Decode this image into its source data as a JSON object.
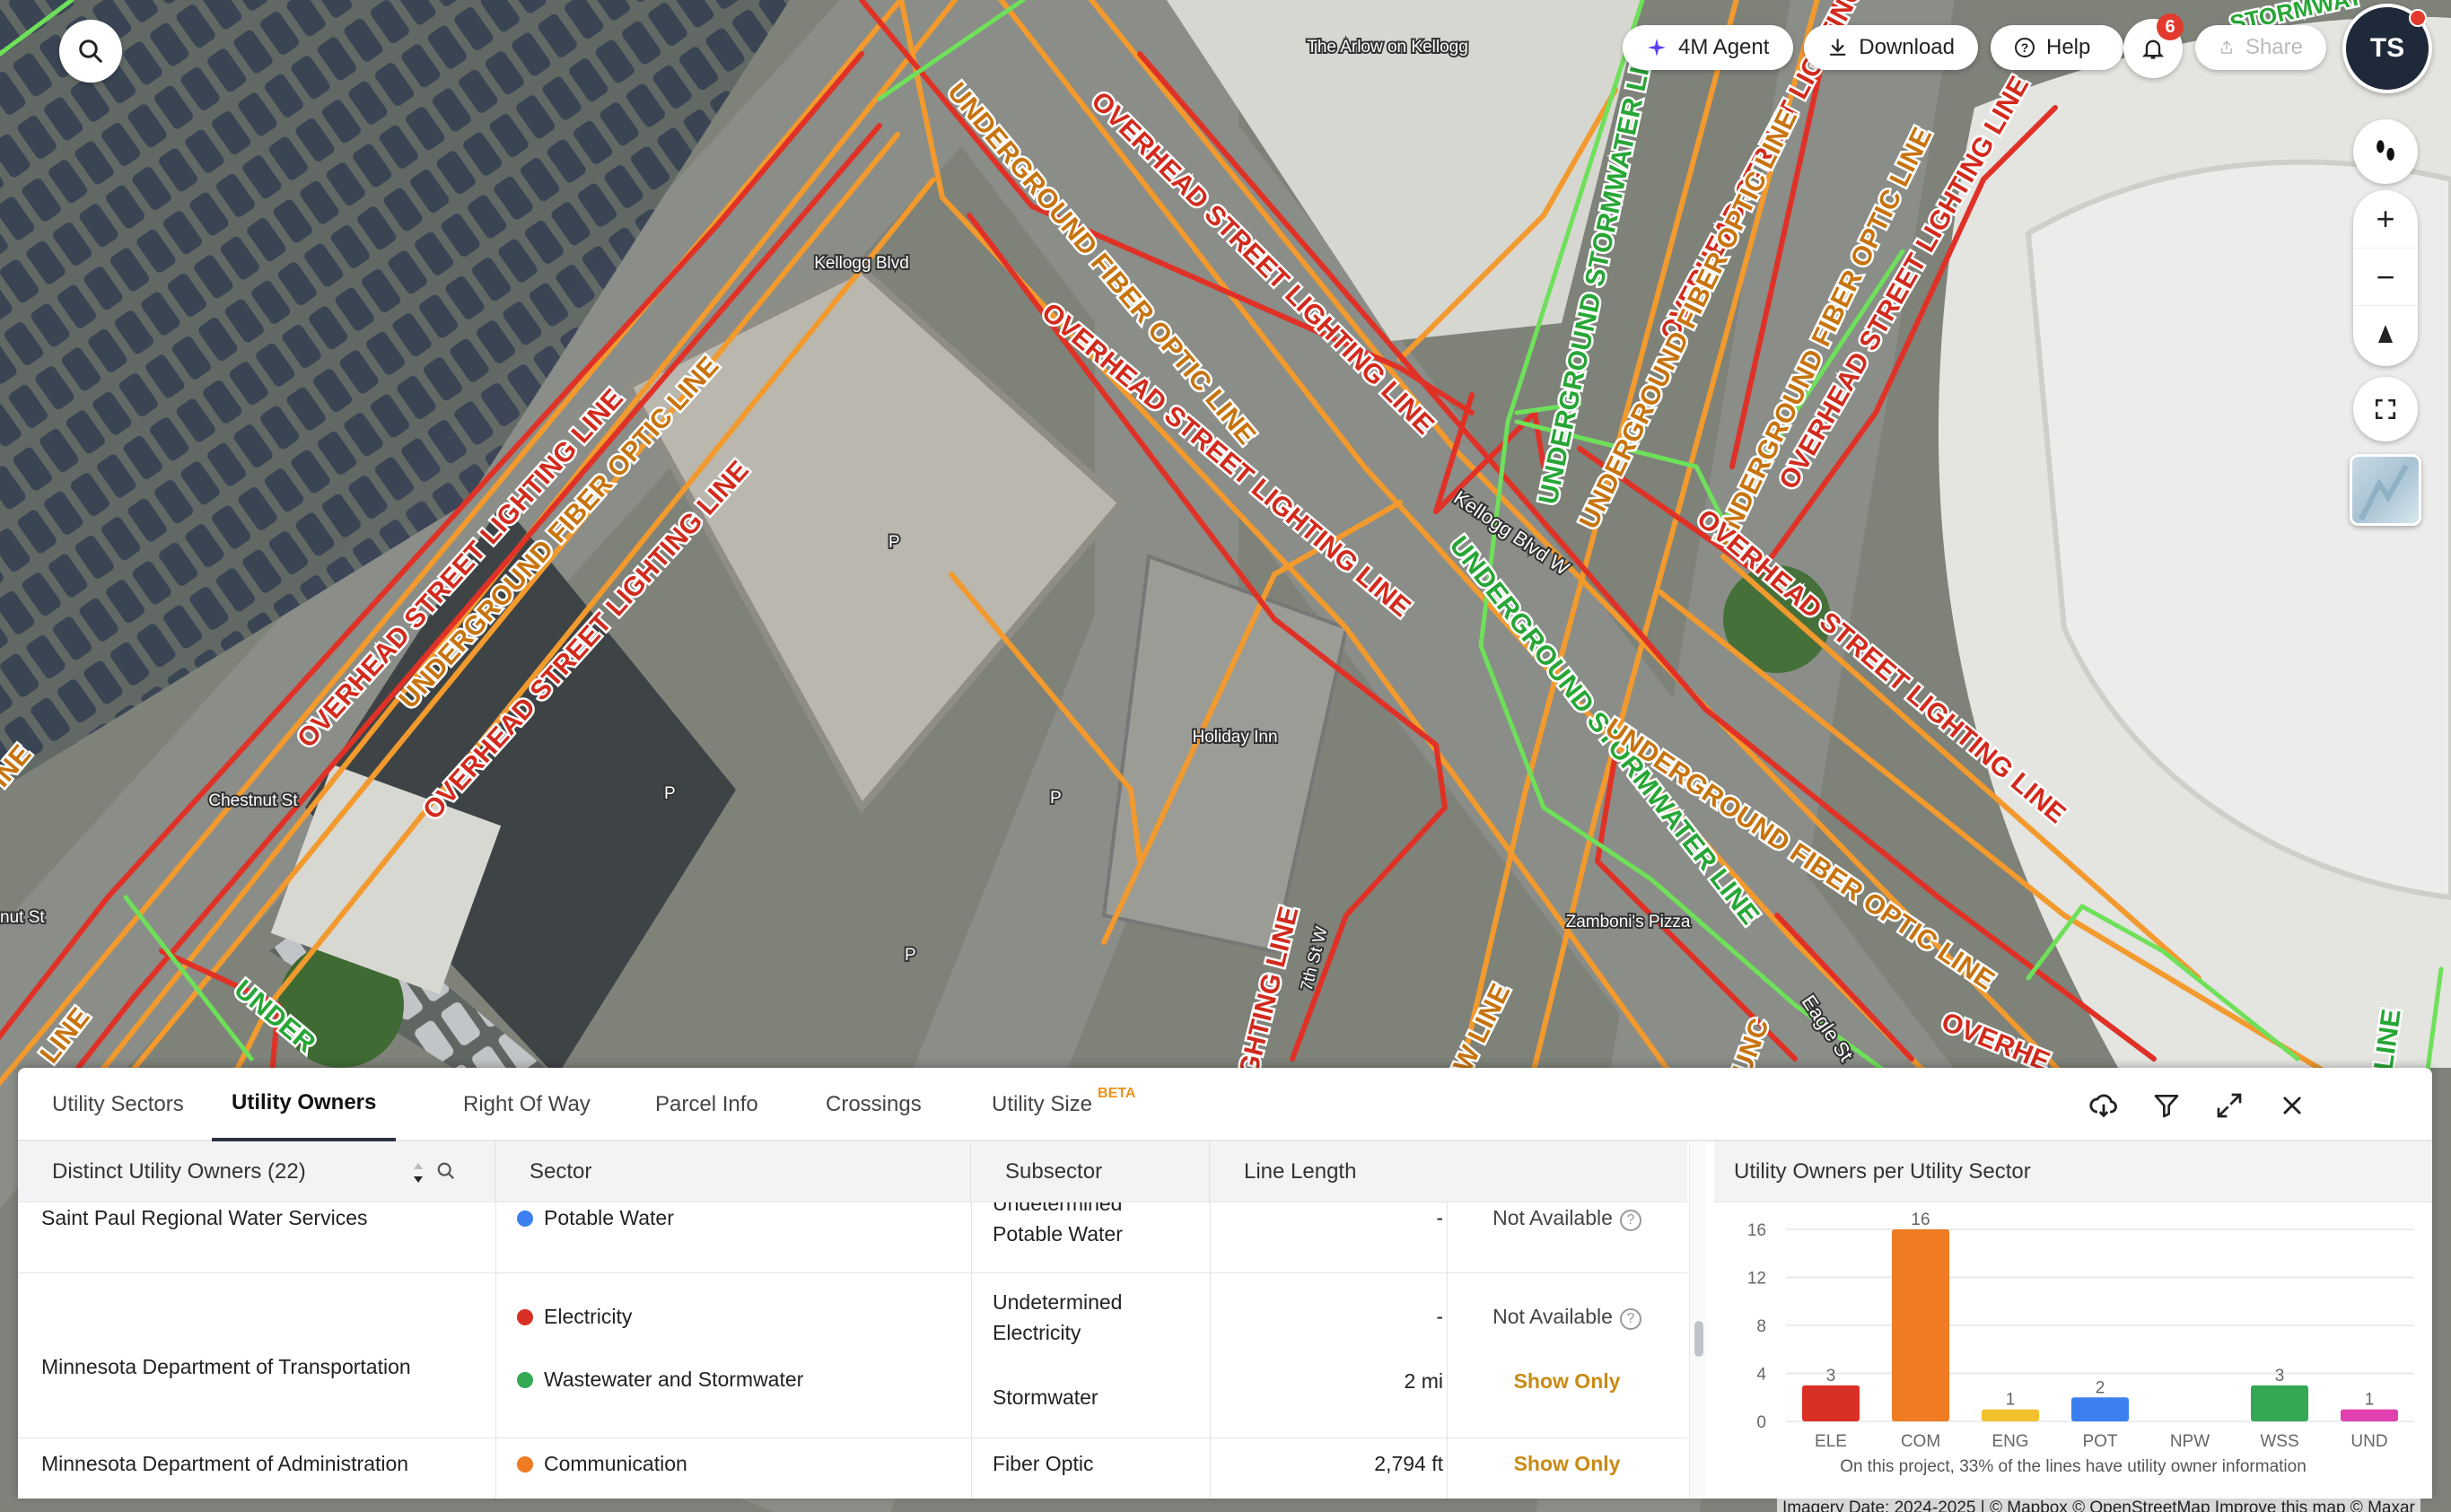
{
  "map": {
    "place_labels": [
      "The Arlow on Kellogg",
      "Kellogg Blvd",
      "Holiday Inn",
      "Chestnut St",
      "Zamboni's Pizza",
      "Kellogg Blvd W",
      "7th St W",
      "Eagle St",
      "nut St"
    ],
    "parking_label": "P",
    "line_labels": {
      "overhead_lighting": "OVERHEAD STREET LIGHTING LINE",
      "underground_fiber": "UNDERGROUND FIBER OPTIC LINE",
      "underground_storm": "UNDERGROUND STORMWATER LINE",
      "storm_short": "STORMWAT",
      "overhe": "OVERHE",
      "lighting_line": "LIGHTING LINE",
      "w_line": "W LINE",
      "under": "UNDER",
      "ine": "INE",
      "line": "LINE",
      "unc": "UNC"
    },
    "colors": {
      "electricity": "#e03127",
      "communication": "#f29a2e",
      "stormwater": "#6ee05a"
    }
  },
  "header": {
    "search_icon": "search-icon",
    "agent_label": "4M Agent",
    "download_label": "Download",
    "help_label": "Help",
    "notifications_count": "6",
    "share_label": "Share",
    "avatar_initials": "TS"
  },
  "controls": {
    "zoom_in": "+",
    "zoom_out": "−"
  },
  "panel": {
    "tabs": [
      {
        "label": "Utility Sectors"
      },
      {
        "label": "Utility Owners"
      },
      {
        "label": "Right Of Way"
      },
      {
        "label": "Parcel Info"
      },
      {
        "label": "Crossings"
      },
      {
        "label": "Utility Size"
      }
    ],
    "beta_label": "BETA",
    "columns": {
      "owners": "Distinct Utility Owners (22)",
      "sector": "Sector",
      "subsector": "Subsector",
      "length": "Line Length"
    },
    "rows": [
      {
        "owner": "Saint Paul Regional Water Services",
        "entries": [
          {
            "sector": "Potable Water",
            "color": "#3b7ff0",
            "subsector_1": "Undetermined",
            "subsector_2": "Potable Water",
            "length": "-",
            "action": "Not Available"
          }
        ]
      },
      {
        "owner": "Minnesota Department of Transportation",
        "entries": [
          {
            "sector": "Electricity",
            "color": "#d93025",
            "subsector_1": "Undetermined",
            "subsector_2": "Electricity",
            "length": "-",
            "action": "Not Available"
          },
          {
            "sector": "Wastewater and Stormwater",
            "color": "#34a853",
            "subsector_1": "Stormwater",
            "length": "2 mi",
            "action": "Show Only"
          }
        ]
      },
      {
        "owner": "Minnesota Department of Administration",
        "entries": [
          {
            "sector": "Communication",
            "color": "#ef7b22",
            "subsector_1": "Fiber Optic",
            "length": "2,794 ft",
            "action": "Show Only"
          }
        ]
      }
    ],
    "chart_note": "On this project, 33% of the lines have utility owner information",
    "attribution": "Imagery Date: 2024-2025 | © Mapbox © OpenStreetMap Improve this map © Maxar"
  },
  "chart_data": {
    "type": "bar",
    "title": "Utility Owners per Utility Sector",
    "categories": [
      "ELE",
      "COM",
      "ENG",
      "POT",
      "NPW",
      "WSS",
      "UND"
    ],
    "values": [
      3,
      16,
      1,
      2,
      0,
      3,
      1
    ],
    "colors": [
      "#d93025",
      "#ef7b22",
      "#f3c12e",
      "#3b7ff0",
      "#9aa0a6",
      "#34a853",
      "#e040b0"
    ],
    "ylim": [
      0,
      16
    ],
    "yticks": [
      0,
      4,
      8,
      12,
      16
    ],
    "grid": true
  }
}
